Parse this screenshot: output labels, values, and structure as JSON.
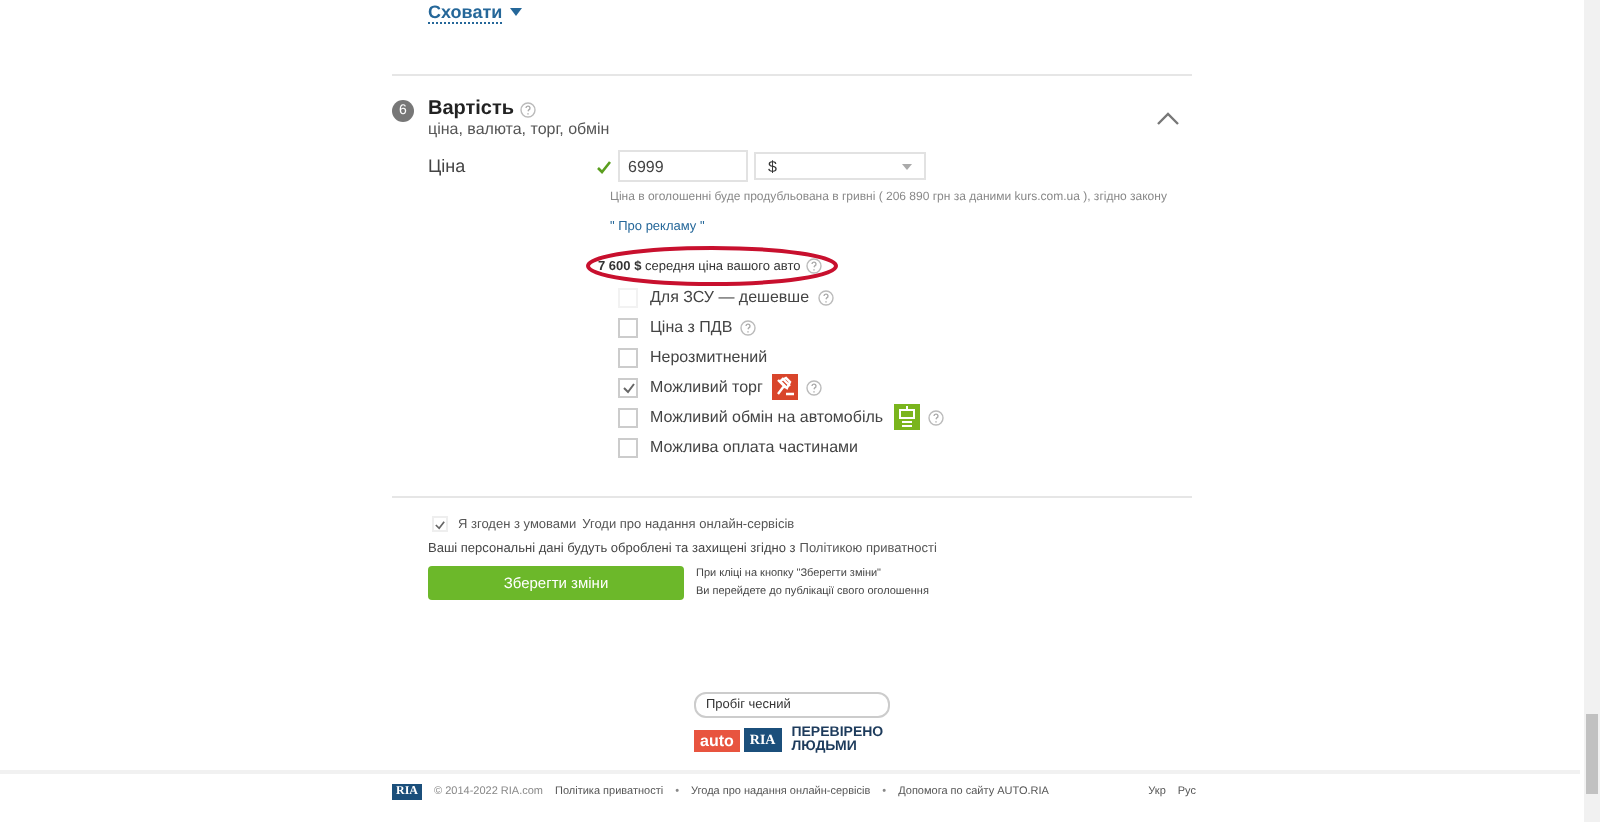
{
  "hide_link": {
    "label": "Сховати"
  },
  "section": {
    "number": "6",
    "title": "Вартість",
    "subtitle": "ціна, валюта, торг, обмін",
    "expanded": true
  },
  "price": {
    "label": "Ціна",
    "value": "6999",
    "currency": "$",
    "valid": true
  },
  "note": {
    "text": "Ціна в оголошенні буде продубльована в гривні ( 206 890 грн за даними kurs.com.ua ), згідно закону",
    "link": "\" Про рекламу \""
  },
  "average": {
    "text": "**7 600 $** середня ціна вашого авто",
    "highlighted": true
  },
  "options": [
    {
      "label": "Для ЗСУ — дешевше",
      "checked": false,
      "disabled": true,
      "help": true,
      "kind": "plain"
    },
    {
      "label": "Ціна з ПДВ",
      "checked": false,
      "disabled": false,
      "help": true,
      "kind": "plain"
    },
    {
      "label": "Нерозмитнений",
      "checked": false,
      "disabled": false,
      "help": false,
      "kind": "plain"
    },
    {
      "label": "Можливий торг",
      "checked": true,
      "disabled": false,
      "help": true,
      "kind": "bargain"
    },
    {
      "label": "Можливий обмін на автомобіль",
      "checked": false,
      "disabled": false,
      "help": true,
      "kind": "exchange"
    },
    {
      "label": "Можлива оплата частинами",
      "checked": false,
      "disabled": false,
      "help": false,
      "kind": "plain"
    }
  ],
  "agreement": {
    "checked": true,
    "text": "Я згоден з умовами",
    "link": "Угоди про надання онлайн-сервісів"
  },
  "privacy": {
    "text": "Ваші персональні дані будуть оброблені та захищені згідно з",
    "link": "Політикою приватності"
  },
  "save": {
    "button": "Зберегти зміни",
    "hint": [
      "При кліці на кнопку \"Зберегти зміни\"",
      "Ви перейдете до публікації свого оголошення"
    ]
  },
  "verified": {
    "field": "Пробіг чесний",
    "brand_a": "auto",
    "brand_b": "RIA",
    "slogan": [
      "ПЕРЕВІРЕНО",
      "ЛЮДЬМИ"
    ]
  },
  "footer": {
    "logo": "RIA",
    "copyright": "© 2014-2022 RIA.com",
    "links": [
      "Політика приватності",
      "Угода про надання онлайн-сервісів",
      "Допомога по сайту AUTO.RIA"
    ],
    "separator": "•",
    "languages": [
      "Укр",
      "Рус"
    ]
  }
}
